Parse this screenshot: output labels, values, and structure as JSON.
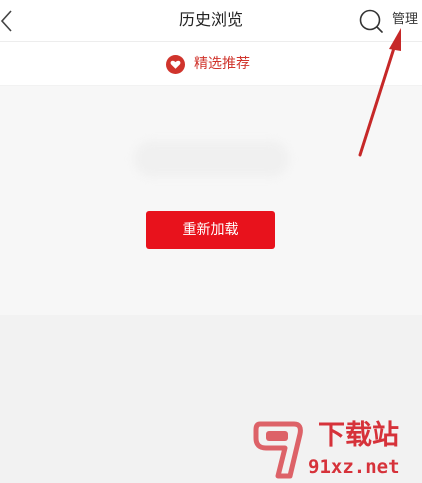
{
  "header": {
    "title": "历史浏览",
    "back_icon": "chevron-left-icon",
    "search_icon": "search-icon",
    "manage_label": "管理"
  },
  "tabs": {
    "featured_label": "精选推荐",
    "featured_icon": "heart-icon"
  },
  "content": {
    "reload_label": "重新加载"
  },
  "watermark": {
    "title": "下载站",
    "domain": "91xz.net"
  },
  "colors": {
    "accent": "#e8121c",
    "tab_text": "#d0342c",
    "arrow": "#c62828",
    "watermark": "#d6323a"
  }
}
